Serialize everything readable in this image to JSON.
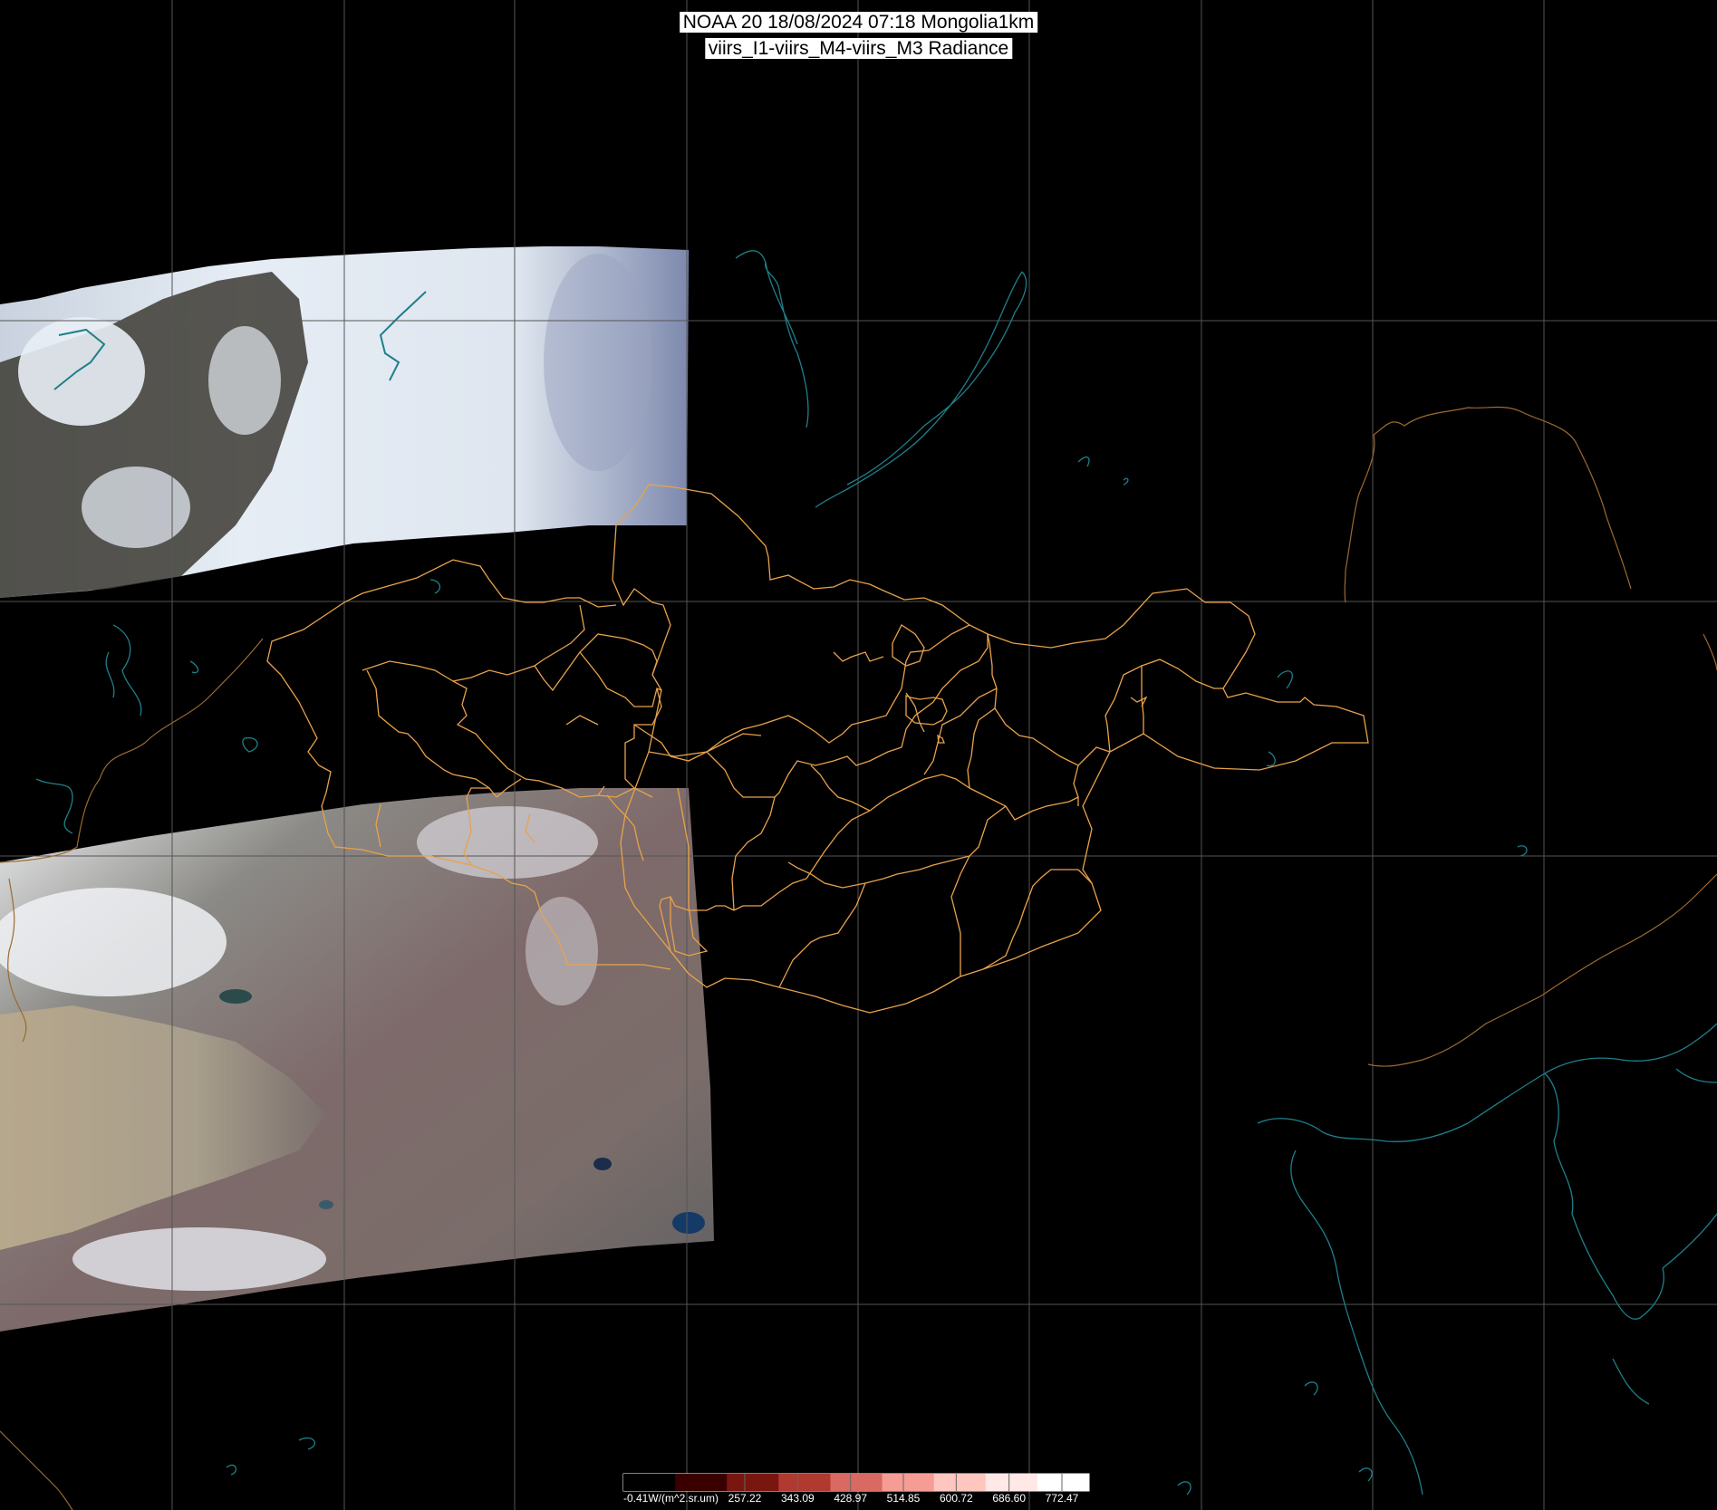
{
  "title": {
    "line1": "NOAA 20 18/08/2024 07:18 Mongolia1km",
    "line2": "viirs_I1-viirs_M4-viirs_M3 Radiance"
  },
  "colors": {
    "background": "#000000",
    "graticule": "#555555",
    "province_borders": "#e9a24a",
    "country_borders": "#9c6a30",
    "coastlines": "#1f7f8a",
    "legend_ramp": [
      "#000000",
      "#3a0000",
      "#7a1610",
      "#b03a30",
      "#d86a62",
      "#f59c94",
      "#ffc6c0",
      "#ffe8e5",
      "#ffffff"
    ]
  },
  "legend": {
    "unit_label": "-0.41W/(m^2.sr.um)",
    "ticks": [
      "257.22",
      "343.09",
      "428.97",
      "514.85",
      "600.72",
      "686.60",
      "772.47"
    ]
  }
}
